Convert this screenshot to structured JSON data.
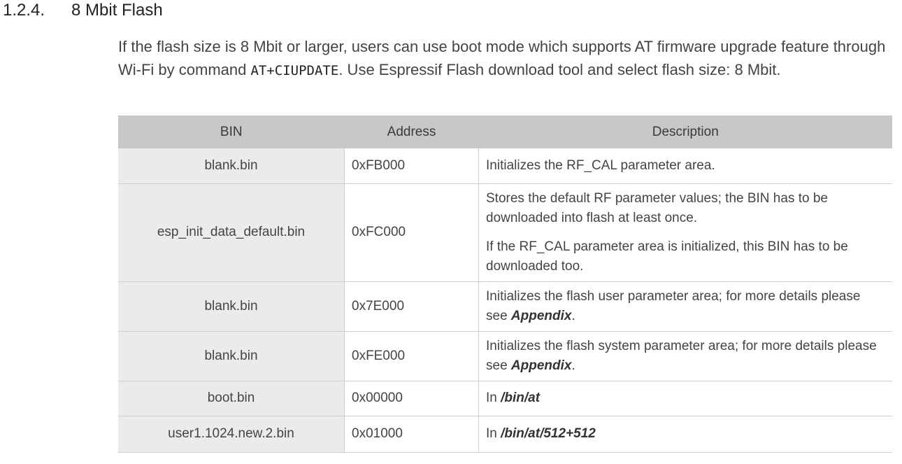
{
  "section": {
    "number": "1.2.4.",
    "title": "8 Mbit Flash"
  },
  "intro": {
    "before": "If the flash size is 8 Mbit or larger, users can use boot mode which supports AT firmware upgrade feature through Wi-Fi by command ",
    "command": "AT+CIUPDATE",
    "after": ". Use Espressif Flash download tool and select flash size: 8 Mbit."
  },
  "table": {
    "headers": [
      "BIN",
      "Address",
      "Description"
    ],
    "rows": [
      {
        "bin": "blank.bin",
        "address": "0xFB000",
        "desc": "Initializes the RF_CAL parameter area."
      },
      {
        "bin": "esp_init_data_default.bin",
        "address": "0xFC000",
        "desc1": "Stores the default RF parameter values; the BIN has to be downloaded into flash at least once.",
        "desc2": "If the RF_CAL parameter area is initialized, this BIN has to be downloaded too."
      },
      {
        "bin": "blank.bin",
        "address": "0x7E000",
        "desc": "Initializes the flash user parameter area; for more details please see ",
        "link": "Appendix",
        "end": "."
      },
      {
        "bin": "blank.bin",
        "address": "0xFE000",
        "desc": "Initializes the flash system parameter area; for more details please see ",
        "link": "Appendix",
        "end": "."
      },
      {
        "bin": "boot.bin",
        "address": "0x00000",
        "desc": "In ",
        "link": "/bin/at"
      },
      {
        "bin": "user1.1024.new.2.bin",
        "address": "0x01000",
        "desc": "In ",
        "link": "/bin/at/512+512"
      }
    ]
  }
}
